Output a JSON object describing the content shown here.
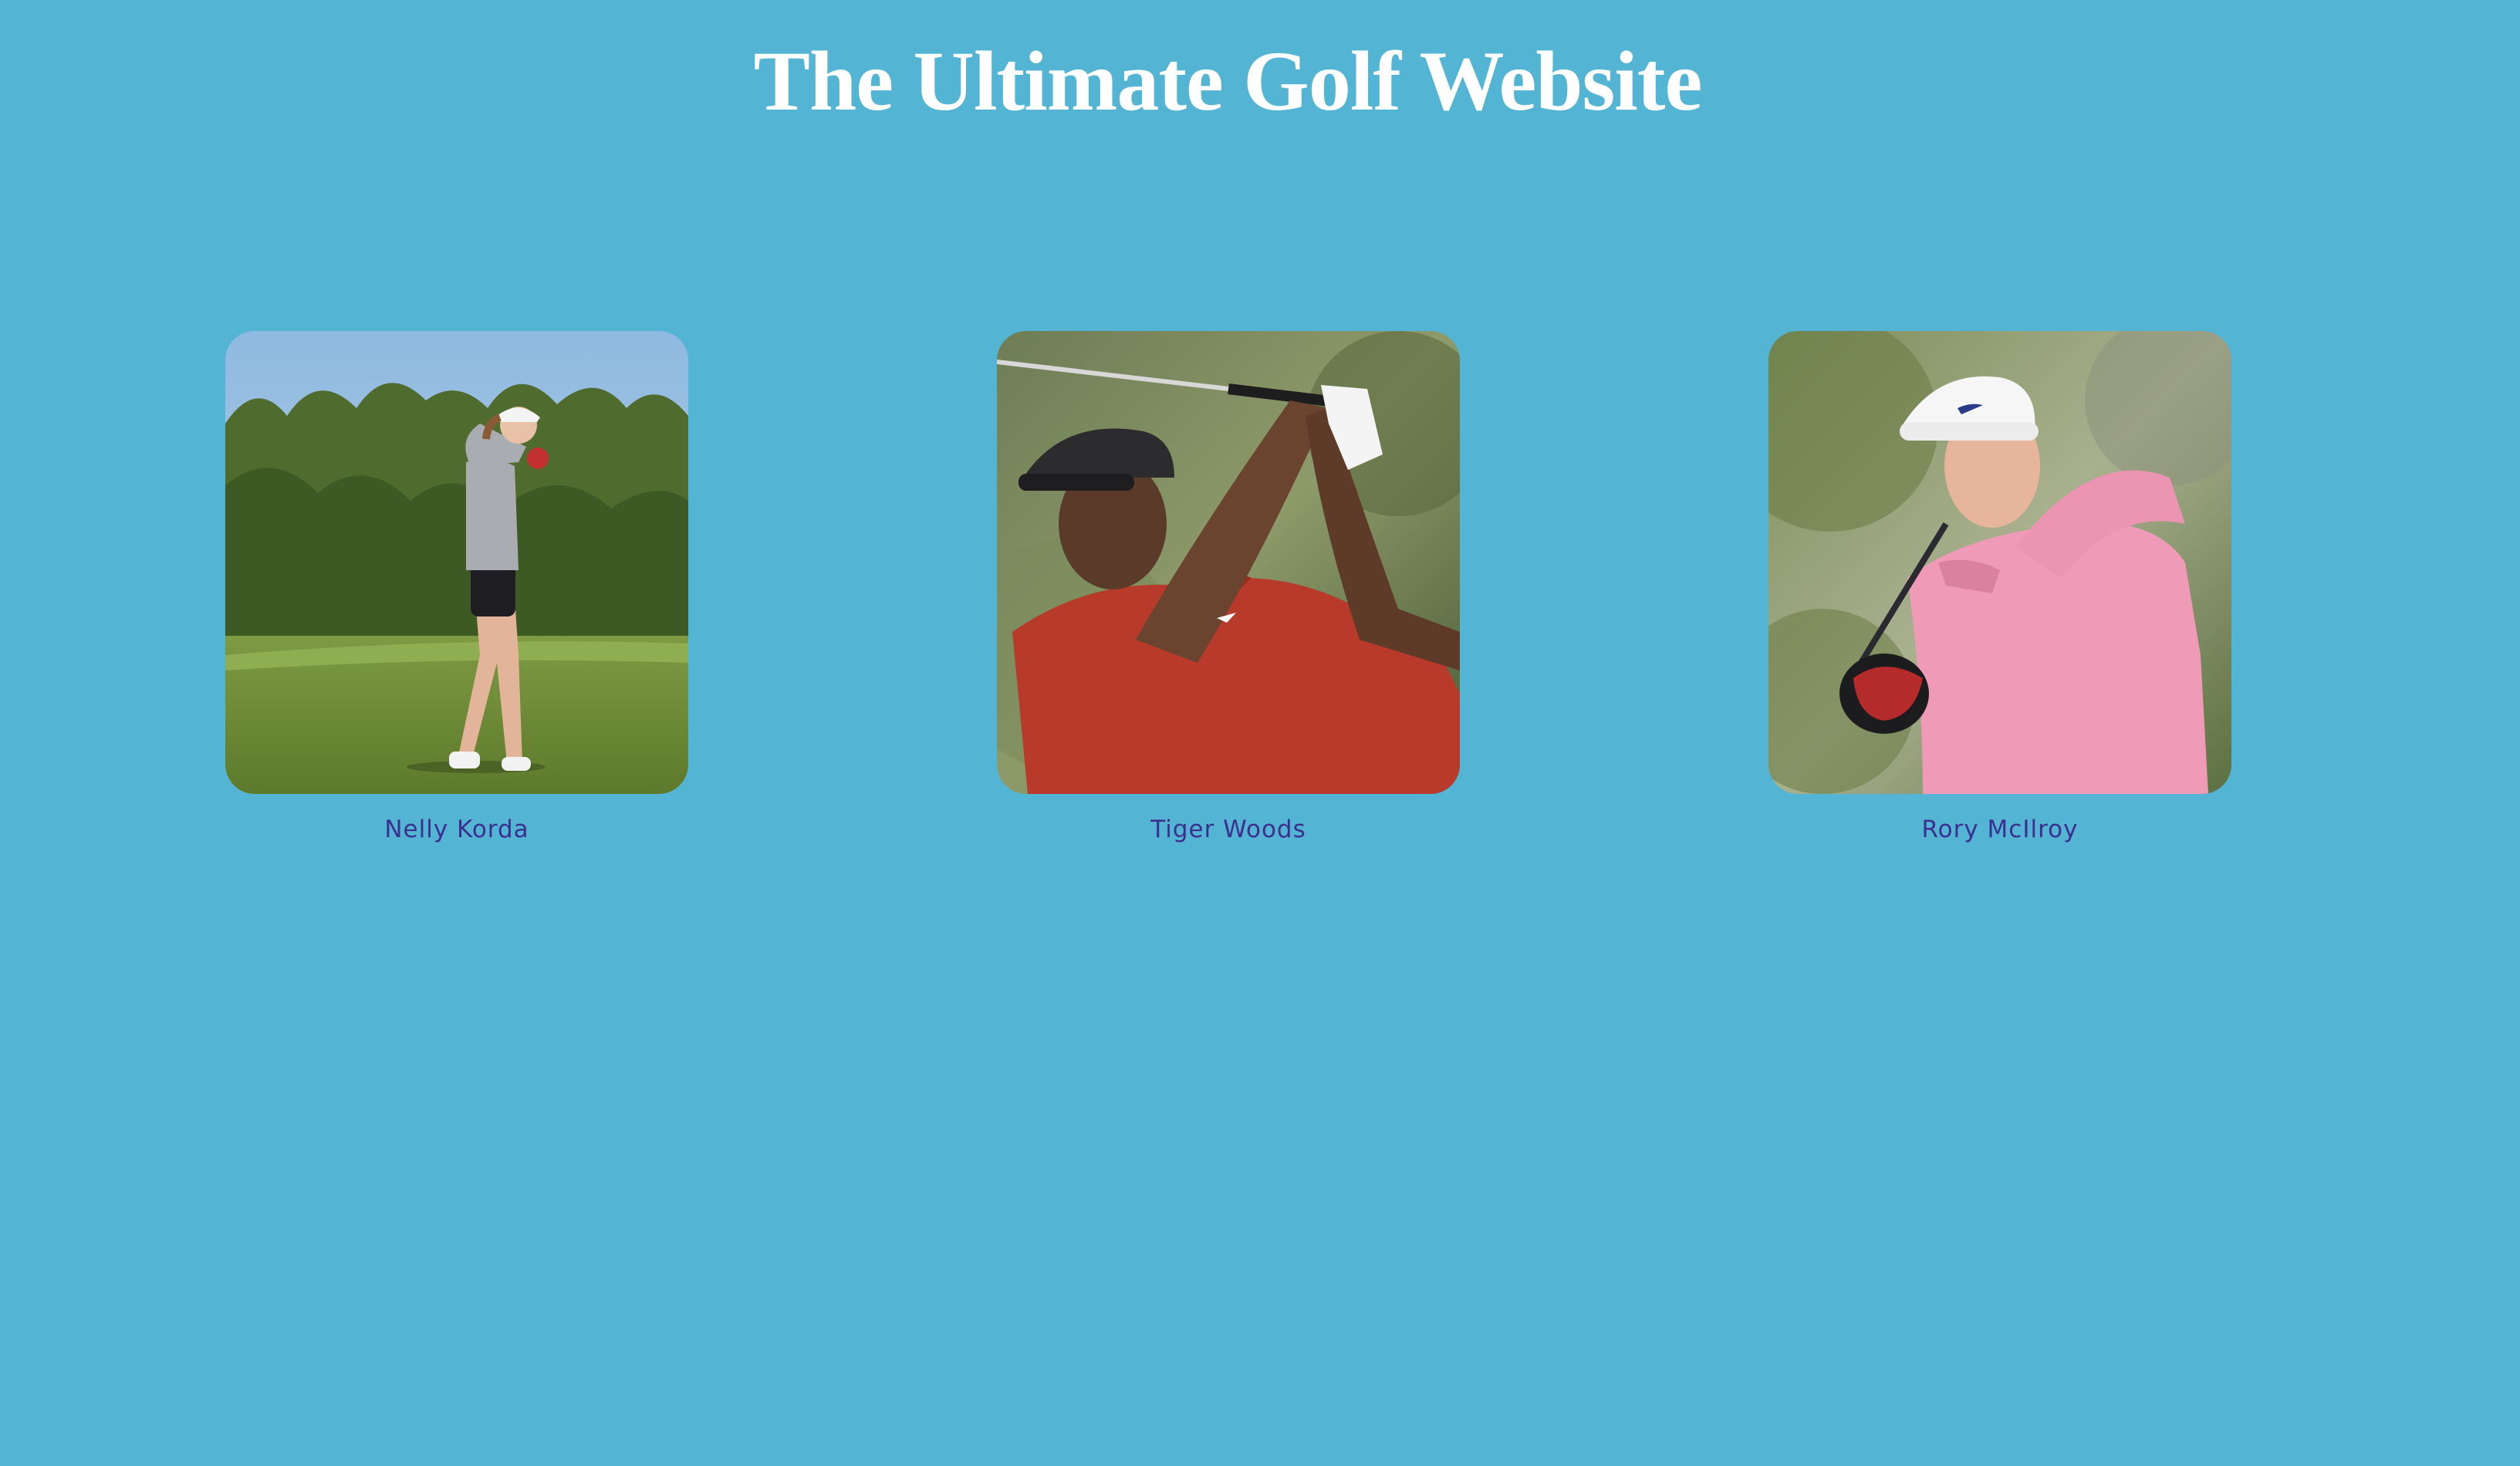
{
  "header": {
    "title": "The Ultimate Golf Website"
  },
  "golfers": [
    {
      "name": "Nelly Korda",
      "photo_icon": "golfer-photo"
    },
    {
      "name": "Tiger Woods",
      "photo_icon": "golfer-photo"
    },
    {
      "name": "Rory McIlroy",
      "photo_icon": "golfer-photo"
    }
  ],
  "colors": {
    "background": "#53b4d3",
    "title": "#ffffff",
    "caption": "#3b2f8f"
  }
}
